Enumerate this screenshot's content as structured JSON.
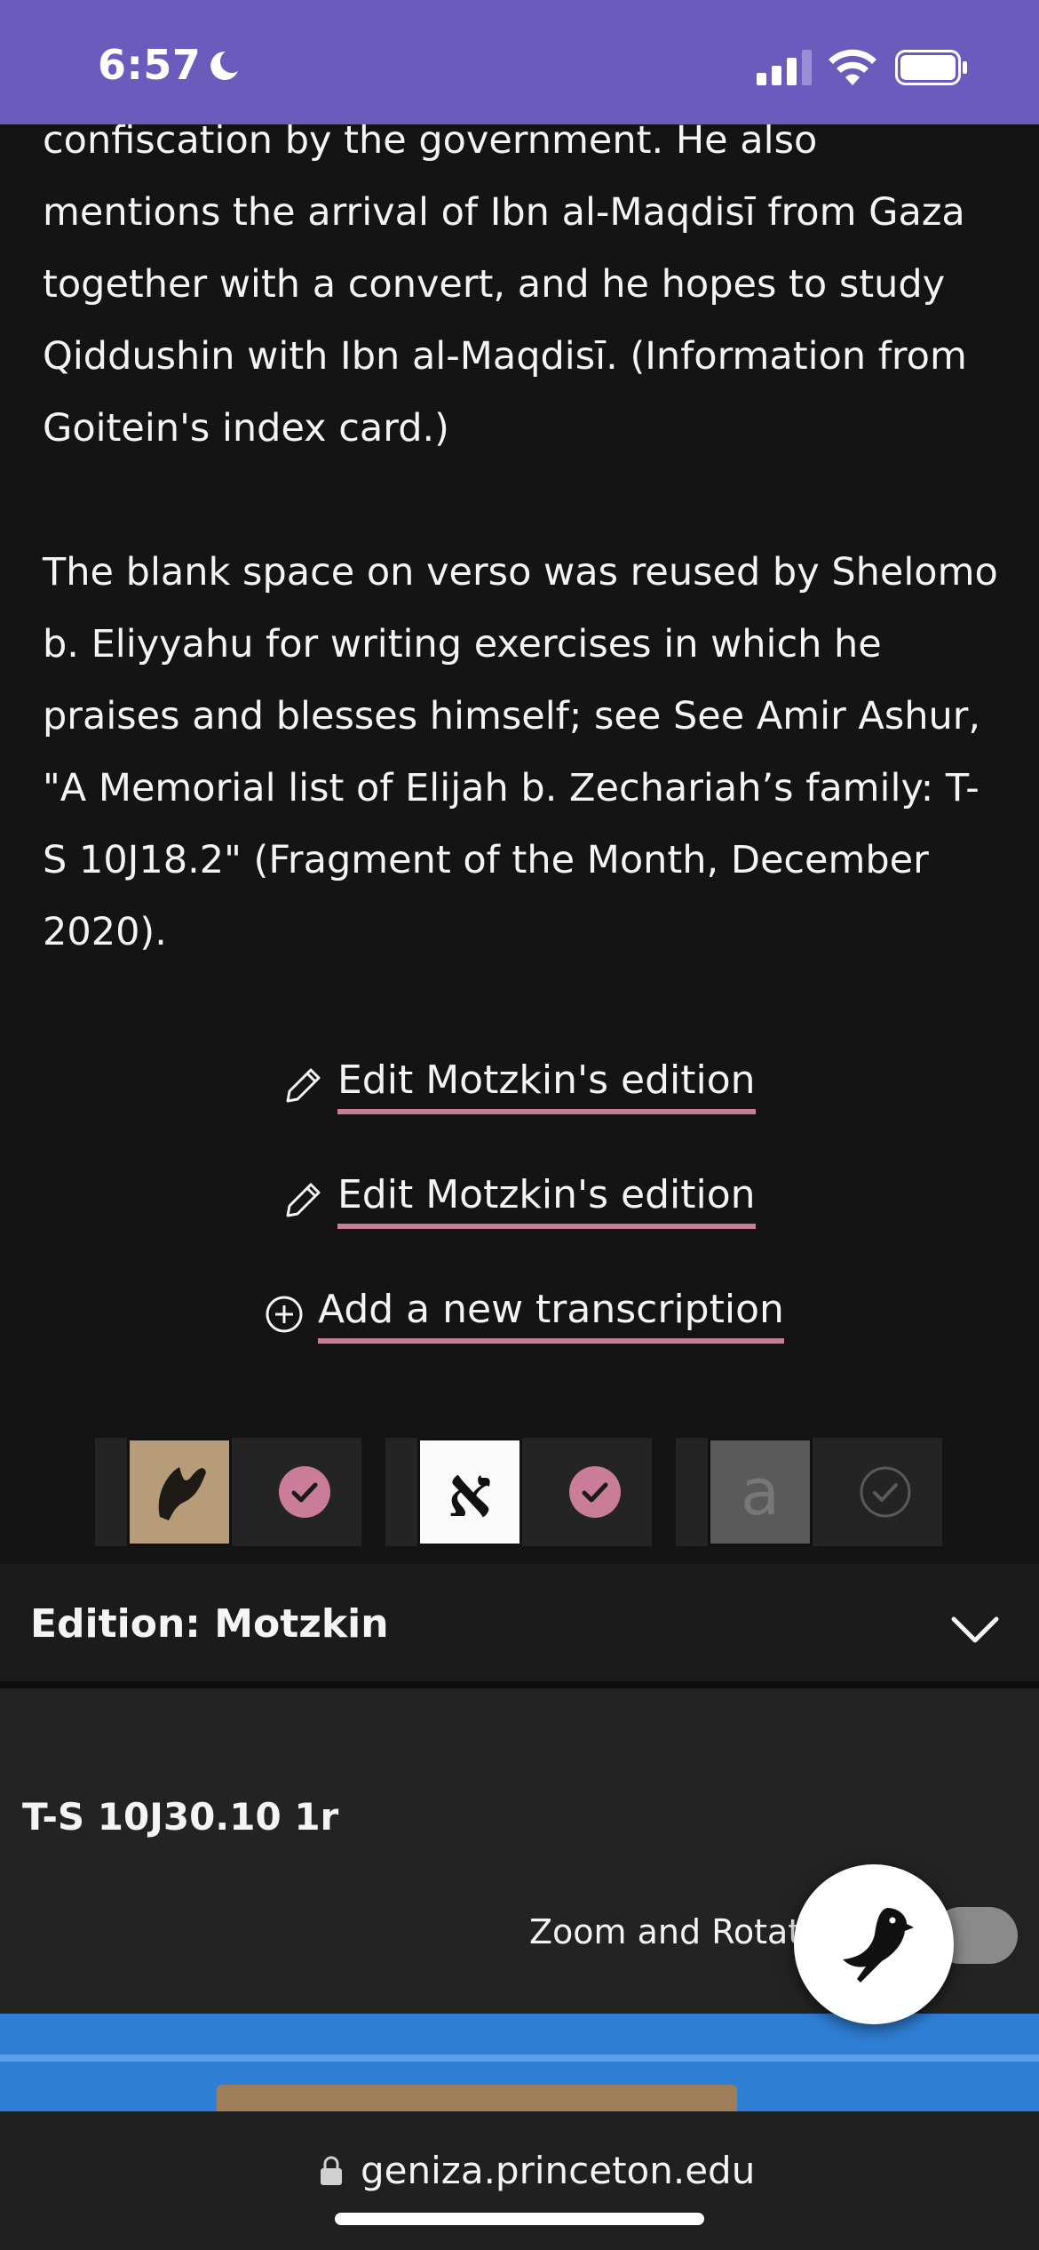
{
  "status_bar": {
    "time": "6:57",
    "background": "#6a5bbd"
  },
  "article": {
    "paragraphs": [
      "confiscation by the government. He also mentions the arrival of Ibn al-Maqdisī from Gaza together with a convert, and he hopes to study Qiddushin with Ibn al-Maqdisī. (Information from Goitein's index card.)",
      "The blank space on verso was reused by Shelomo b. Eliyyahu for writing exercises in which he praises and blesses himself; see See Amir Ashur, \"A Memorial list of Elijah b. Zechariah’s family: T-S 10J18.2\" (Fragment of the Month, December 2020)."
    ]
  },
  "actions": {
    "edit_1": "Edit Motzkin's edition",
    "edit_2": "Edit Motzkin's edition",
    "add_new": "Add a new transcription",
    "underline_color": "#c97d98"
  },
  "viewer_modes": {
    "images_checked": true,
    "hebrew_glyph": "א",
    "hebrew_checked": true,
    "translation_glyph": "a",
    "translation_checked": false
  },
  "edition": {
    "label": "Edition: Motzkin"
  },
  "viewer": {
    "shelfmark": "T-S 10J30.10 1r",
    "zoom_label": "Zoom and Rotat"
  },
  "browser": {
    "url": "geniza.princeton.edu"
  }
}
